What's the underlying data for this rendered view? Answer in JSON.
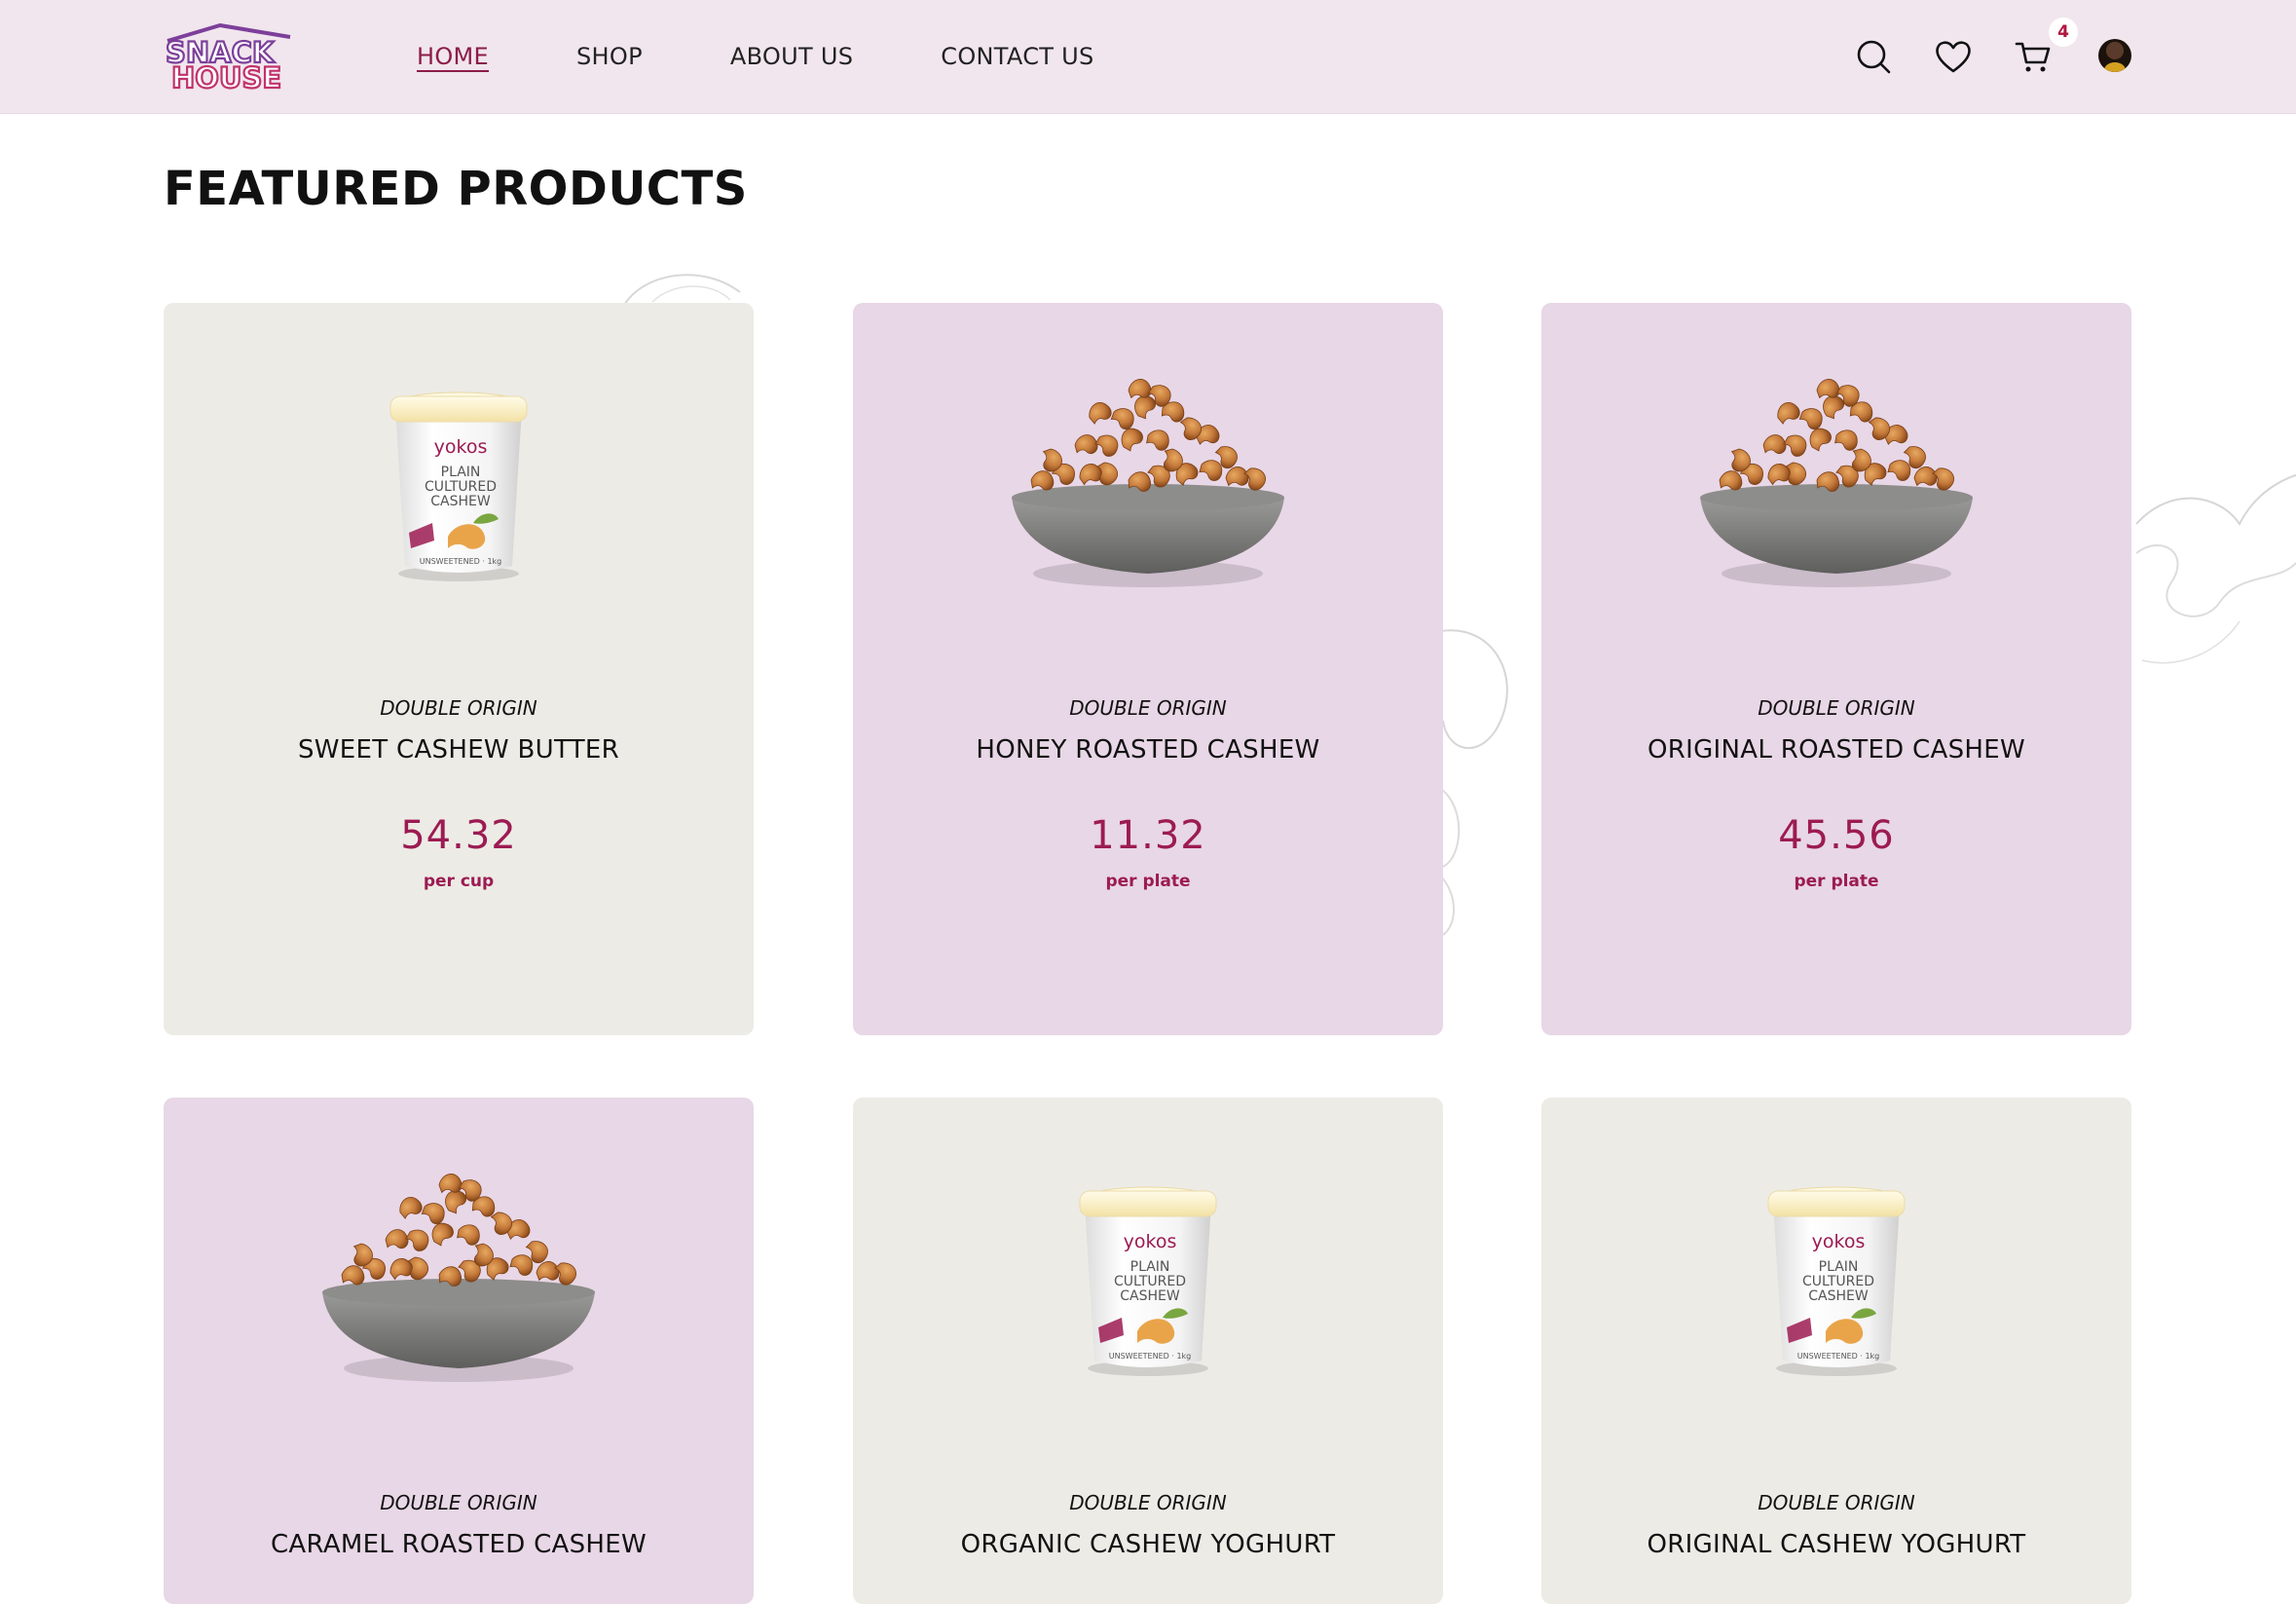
{
  "brand": {
    "logo_line1": "SNACK",
    "logo_line2": "HOUSE",
    "color": "#9c1b52"
  },
  "nav": {
    "items": [
      {
        "label": "HOME",
        "active": true
      },
      {
        "label": "SHOP",
        "active": false
      },
      {
        "label": "ABOUT US",
        "active": false
      },
      {
        "label": "CONTACT US",
        "active": false
      }
    ]
  },
  "header_icons": {
    "search": "search-icon",
    "wishlist": "heart-icon",
    "cart": "cart-icon",
    "cart_count": "4",
    "profile": "avatar"
  },
  "section": {
    "title": "FEATURED PRODUCTS"
  },
  "products": [
    {
      "origin": "DOUBLE ORIGIN",
      "name": "SWEET CASHEW BUTTER",
      "price": "54.32",
      "unit": "per cup",
      "image": "yoghurt-cup",
      "cup_brand": "yokos",
      "cup_line1": "PLAIN",
      "cup_line2": "CULTURED",
      "cup_line3": "CASHEW",
      "cup_footer": "UNSWEETENED · 1kg",
      "bg": "#edebe6"
    },
    {
      "origin": "DOUBLE ORIGIN",
      "name": "HONEY ROASTED CASHEW",
      "price": "11.32",
      "unit": "per plate",
      "image": "cashew-bowl",
      "bg": "#e8d7e6"
    },
    {
      "origin": "DOUBLE ORIGIN",
      "name": "ORIGINAL ROASTED CASHEW",
      "price": "45.56",
      "unit": "per plate",
      "image": "cashew-bowl",
      "bg": "#e8d7e6"
    },
    {
      "origin": "DOUBLE ORIGIN",
      "name": "CARAMEL ROASTED CASHEW",
      "price": "",
      "unit": "",
      "image": "cashew-bowl",
      "bg": "#e8d7e6"
    },
    {
      "origin": "DOUBLE ORIGIN",
      "name": "ORGANIC CASHEW YOGHURT",
      "price": "",
      "unit": "",
      "image": "yoghurt-cup",
      "cup_brand": "yokos",
      "cup_line1": "PLAIN",
      "cup_line2": "CULTURED",
      "cup_line3": "CASHEW",
      "cup_footer": "UNSWEETENED · 1kg",
      "bg": "#edebe6"
    },
    {
      "origin": "DOUBLE ORIGIN",
      "name": "ORIGINAL CASHEW YOGHURT",
      "price": "",
      "unit": "",
      "image": "yoghurt-cup",
      "cup_brand": "yokos",
      "cup_line1": "PLAIN",
      "cup_line2": "CULTURED",
      "cup_line3": "CASHEW",
      "cup_footer": "UNSWEETENED · 1kg",
      "bg": "#edebe6"
    }
  ]
}
